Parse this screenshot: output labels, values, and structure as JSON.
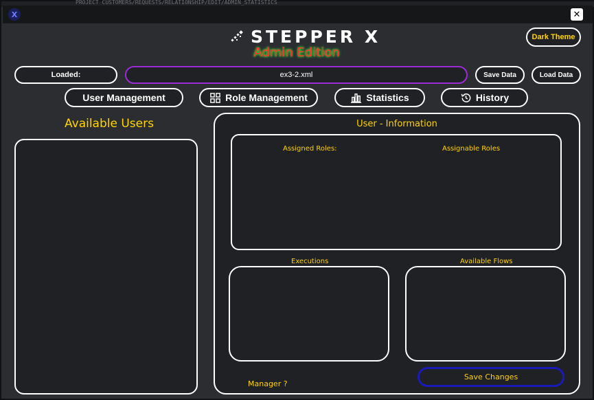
{
  "window": {
    "background_text": "PROJECT CUSTOMERS/REQUESTS/RELATIONSHIP/EDIT/ADMIN_STATISTICS"
  },
  "header": {
    "logo_text": "STEPPER X",
    "subtitle": "Admin Edition",
    "theme_button": "Dark Theme",
    "close_label": "✕"
  },
  "file_bar": {
    "loaded_label": "Loaded:",
    "file_name": "ex3-2.xml",
    "save_label": "Save Data",
    "load_label": "Load Data"
  },
  "tabs": [
    {
      "label": "User Management",
      "icon": "user-icon"
    },
    {
      "label": "Role Management",
      "icon": "grid-icon"
    },
    {
      "label": "Statistics",
      "icon": "bar-chart-icon"
    },
    {
      "label": "History",
      "icon": "history-icon"
    }
  ],
  "users_panel": {
    "title": "Available Users"
  },
  "info_panel": {
    "title": "User - Information",
    "assigned_roles_label": "Assigned Roles:",
    "assignable_roles_label": "Assignable Roles",
    "executions_label": "Executions",
    "available_flows_label": "Available Flows",
    "manager_label": "Manager ?",
    "save_changes_label": "Save Changes"
  },
  "colors": {
    "accent_yellow": "#ffd400",
    "file_field_border": "#9c2bd6",
    "save_changes_border": "#1a1ab8",
    "subtitle_red": "#ff2a2a",
    "subtitle_glow": "#40ff40",
    "background": "#2b2d31"
  }
}
